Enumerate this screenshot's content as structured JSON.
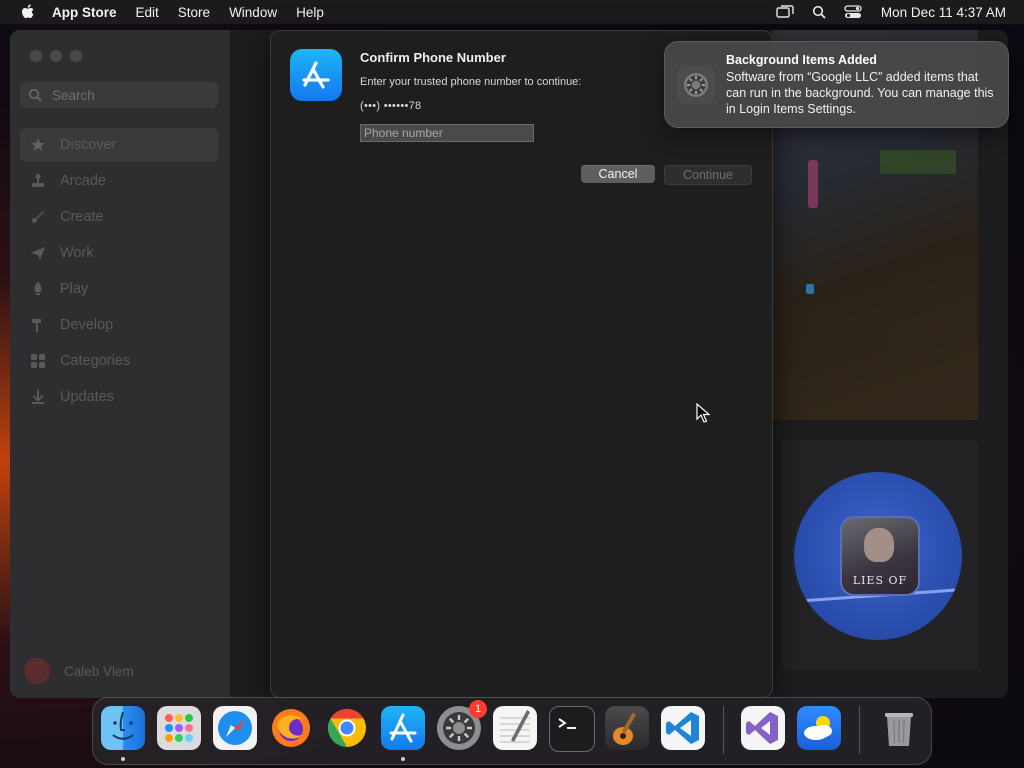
{
  "menubar": {
    "app_name": "App Store",
    "menus": [
      "Edit",
      "Store",
      "Window",
      "Help"
    ],
    "clock": "Mon Dec 11  4:37 AM"
  },
  "sidebar": {
    "search_placeholder": "Search",
    "items": [
      {
        "label": "Discover",
        "selected": true
      },
      {
        "label": "Arcade"
      },
      {
        "label": "Create"
      },
      {
        "label": "Work"
      },
      {
        "label": "Play"
      },
      {
        "label": "Develop"
      },
      {
        "label": "Categories"
      },
      {
        "label": "Updates"
      }
    ],
    "account_name": "Caleb Vlem"
  },
  "game": {
    "icon_title": "LIES OF"
  },
  "dialog": {
    "title": "Confirm Phone Number",
    "subtitle": "Enter your trusted phone number to continue:",
    "masked_number": "(•••) ••••••78",
    "phone_placeholder": "Phone number",
    "cancel_label": "Cancel",
    "continue_label": "Continue"
  },
  "notification": {
    "title": "Background Items Added",
    "body": "Software from “Google LLC” added items that can run in the background. You can manage this in Login Items Settings."
  },
  "dock": {
    "settings_badge": "1",
    "apps": [
      "finder-icon",
      "launchpad-icon",
      "safari-icon",
      "firefox-icon",
      "chrome-icon",
      "app-store-icon",
      "system-settings-icon",
      "textedit-icon",
      "terminal-icon",
      "garageband-icon",
      "vscode-icon",
      "visual-studio-icon",
      "weather-icon",
      "trash-icon"
    ]
  },
  "colors": {
    "accent": "#1378f0",
    "badge": "#ff3b30"
  }
}
